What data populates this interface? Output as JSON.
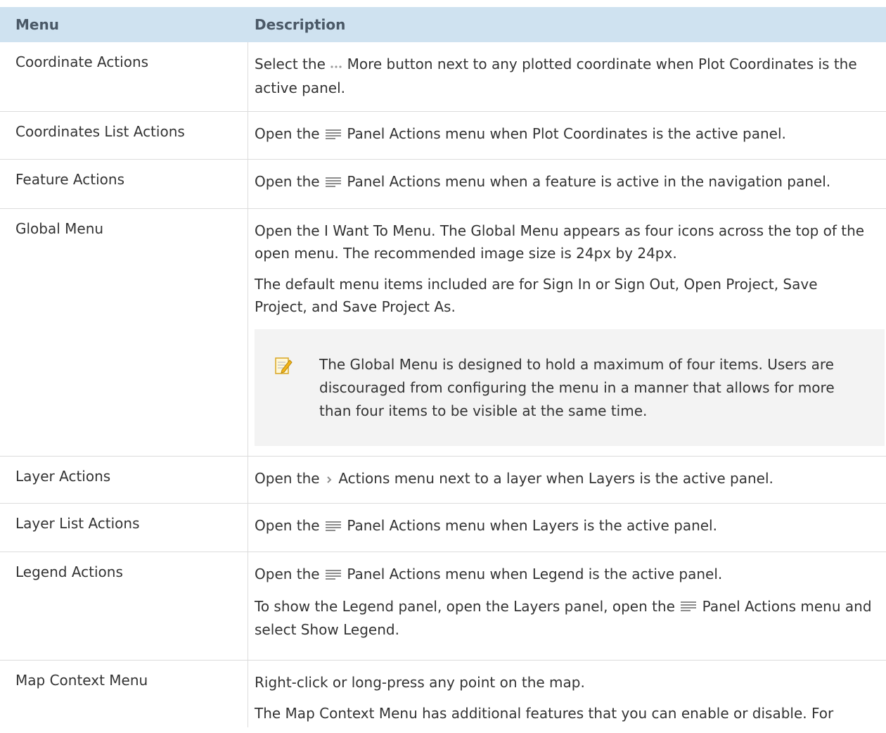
{
  "table": {
    "headers": {
      "menu": "Menu",
      "description": "Description"
    },
    "rows": [
      {
        "menu": "Coordinate Actions",
        "d1": {
          "before": "Select the",
          "icon": "more-dots-icon",
          "after": "More button next to any plotted coordinate when Plot Coordinates is the active panel."
        }
      },
      {
        "menu": "Coordinates List Actions",
        "d1": {
          "before": "Open the",
          "icon": "hamburger-menu-icon",
          "after": "Panel Actions menu when Plot Coordinates is the active panel."
        }
      },
      {
        "menu": "Feature Actions",
        "d1": {
          "before": "Open the",
          "icon": "hamburger-menu-icon",
          "after": "Panel Actions menu when a feature is active in the navigation panel."
        }
      },
      {
        "menu": "Global Menu",
        "d1": {
          "text": "Open the I Want To Menu. The Global Menu appears as four icons across the top of the open menu. The recommended image size is 24px by 24px."
        },
        "d2": {
          "text": "The default menu items included are for Sign In or Sign Out, Open Project, Save Project, and Save Project As."
        },
        "note": {
          "icon": "note-pencil-icon",
          "text": "The Global Menu is designed to hold a maximum of four items. Users are discouraged from configuring the menu in a manner that allows for more than four items to be visible at the same time."
        }
      },
      {
        "menu": "Layer Actions",
        "d1": {
          "before": "Open the",
          "icon": "chevron-right-icon",
          "after": "Actions menu next to a layer when Layers is the active panel."
        }
      },
      {
        "menu": "Layer List Actions",
        "d1": {
          "before": "Open the",
          "icon": "hamburger-menu-icon",
          "after": "Panel Actions menu when Layers is the active panel."
        }
      },
      {
        "menu": "Legend Actions",
        "d1": {
          "before": "Open the",
          "icon": "hamburger-menu-icon",
          "after": "Panel Actions menu when Legend is the active panel."
        },
        "d2": {
          "before": "To show the Legend panel, open the Layers panel, open the",
          "icon": "hamburger-menu-icon",
          "after": "Panel Actions menu and select Show Legend."
        }
      },
      {
        "menu": "Map Context Menu",
        "d1": {
          "text": "Right-click or long-press any point on the map."
        },
        "d2": {
          "text": "The Map Context Menu has additional features that you can enable or disable. For"
        }
      }
    ]
  },
  "colors": {
    "header_bg": "#cfe2f0",
    "header_text": "#4a5866",
    "note_bg": "#f3f3f3",
    "border": "#dcdcdc",
    "icon_gray": "#8c8c8c"
  }
}
